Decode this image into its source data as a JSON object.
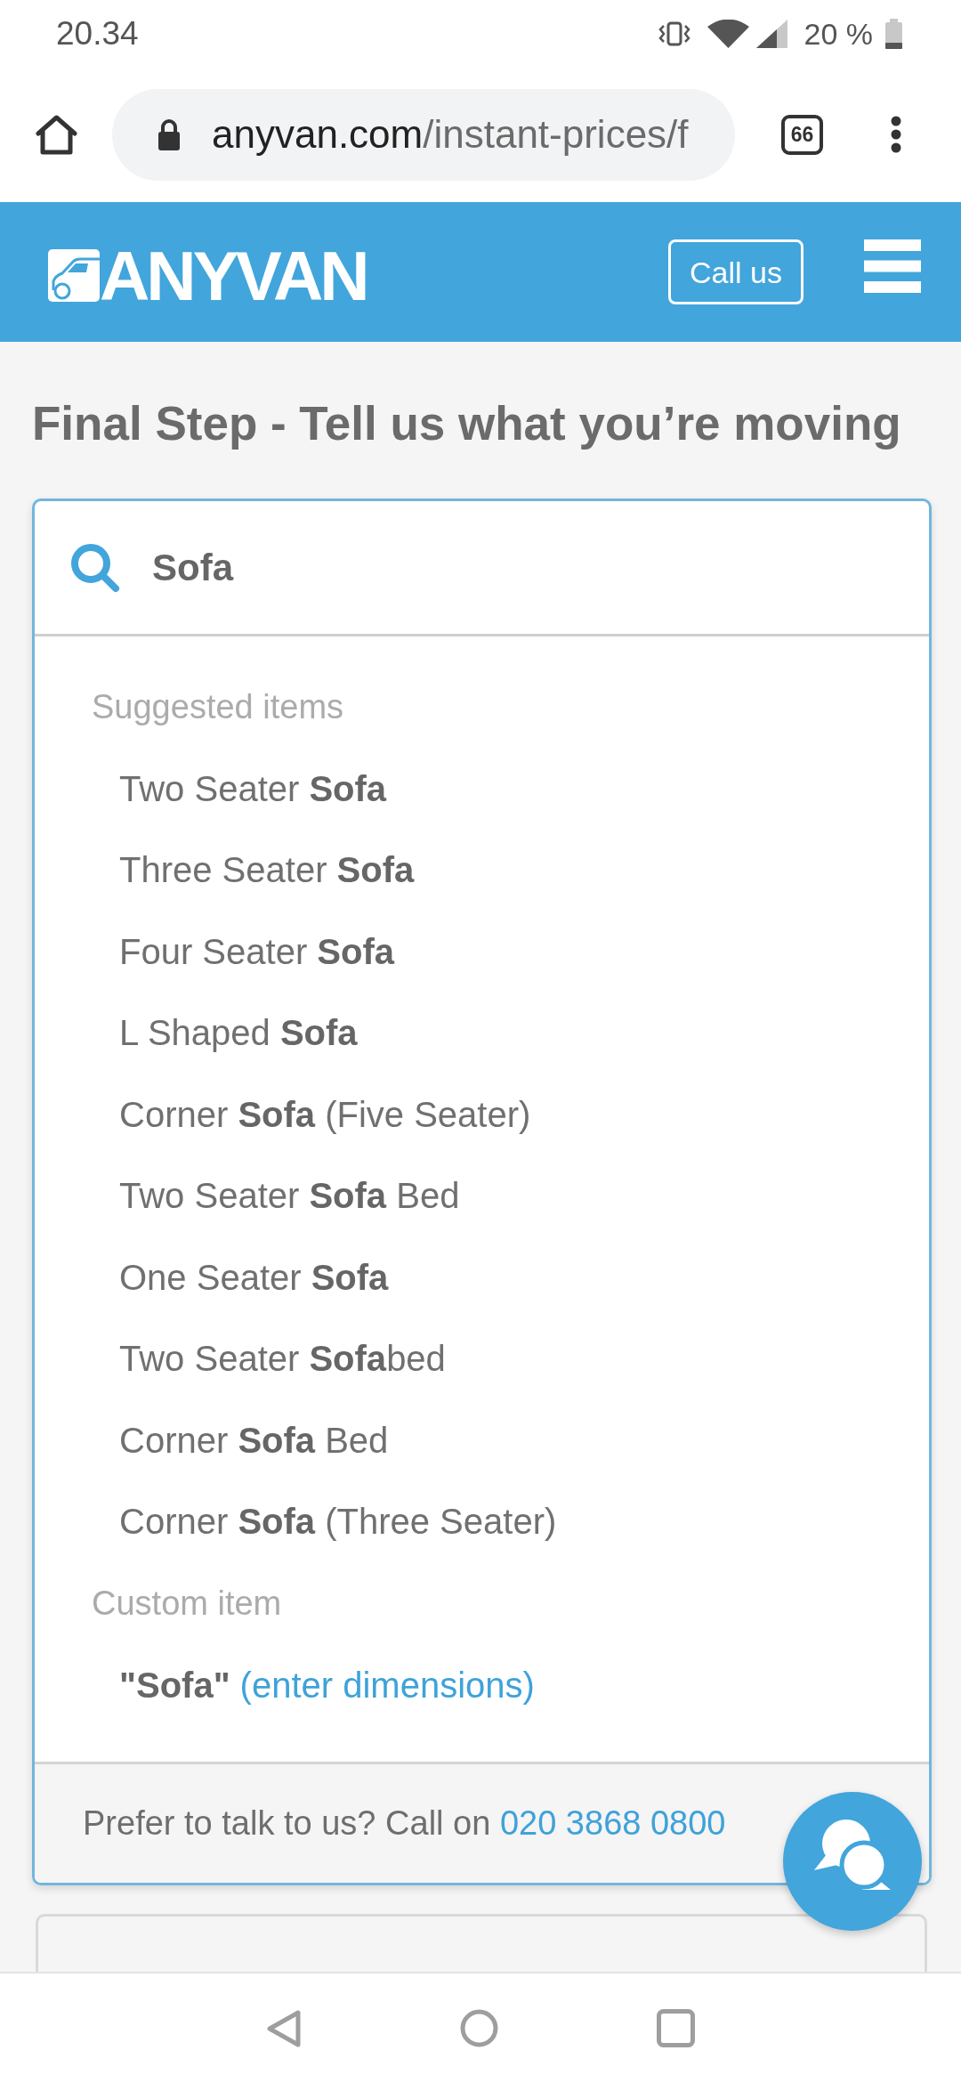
{
  "status_bar": {
    "time": "20.34",
    "battery": "20 %"
  },
  "browser_toolbar": {
    "url_host": "anyvan.com",
    "url_path": "/instant-prices/f",
    "tab_count": "66"
  },
  "header": {
    "logo": "ANYVAN",
    "call_button": "Call us"
  },
  "heading": "Final Step - Tell us what you’re moving",
  "search": {
    "value": "Sofa"
  },
  "suggestions": {
    "title": "Suggested items",
    "items": [
      "Two Seater **Sofa**",
      "Three Seater **Sofa**",
      "Four Seater **Sofa**",
      "L Shaped **Sofa**",
      "Corner **Sofa** (Five Seater)",
      "Two Seater **Sofa** Bed",
      "One Seater **Sofa**",
      "Two Seater **Sofa**bed",
      "Corner **Sofa** Bed",
      "Corner **Sofa** (Three Seater)"
    ]
  },
  "custom_item": {
    "title": "Custom item",
    "name": "\"Sofa\"",
    "link": "(enter dimensions)"
  },
  "footer": {
    "text": "Prefer to talk to us? Call on",
    "phone": "020 3868 0800"
  }
}
